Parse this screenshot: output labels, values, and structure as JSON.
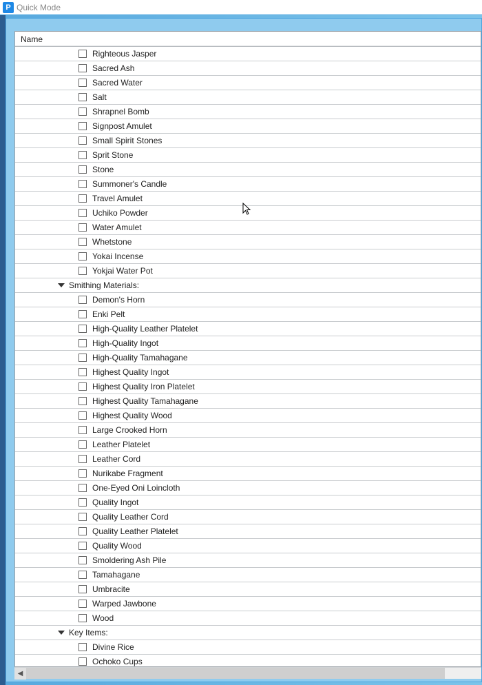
{
  "window": {
    "title": "Quick Mode"
  },
  "grid": {
    "header": "Name",
    "preItems": [
      "Righteous Jasper",
      "Sacred Ash",
      "Sacred Water",
      "Salt",
      "Shrapnel Bomb",
      "Signpost Amulet",
      "Small Spirit Stones",
      "Sprit Stone",
      "Stone",
      "Summoner's Candle",
      "Travel Amulet",
      "Uchiko Powder",
      "Water Amulet",
      "Whetstone",
      "Yokai Incense",
      "Yokjai Water Pot"
    ],
    "categories": [
      {
        "label": "Smithing Materials:",
        "items": [
          "Demon's Horn",
          "Enki Pelt",
          "High-Quality Leather Platelet",
          "High-Quality Ingot",
          "High-Quality Tamahagane",
          "Highest Quality Ingot",
          "Highest Quality Iron Platelet",
          "Highest Quality Tamahagane",
          "Highest Quality Wood",
          "Large Crooked Horn",
          "Leather Platelet",
          "Leather Cord",
          "Nurikabe Fragment",
          "One-Eyed Oni Loincloth",
          "Quality Ingot",
          "Quality Leather Cord",
          "Quality Leather Platelet",
          "Quality Wood",
          "Smoldering Ash Pile",
          "Tamahagane",
          "Umbracite",
          "Warped Jawbone",
          "Wood"
        ]
      },
      {
        "label": "Key Items:",
        "items": [
          "Divine Rice",
          "Ochoko Cups"
        ]
      }
    ]
  }
}
